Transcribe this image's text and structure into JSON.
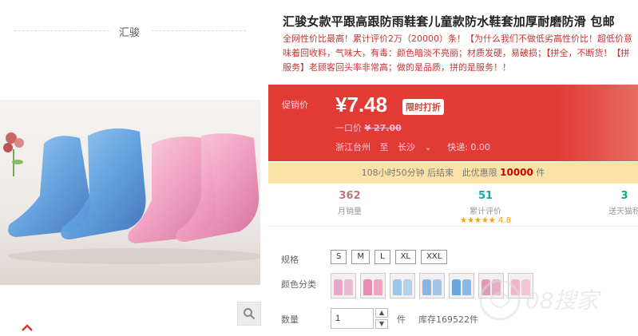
{
  "brand": {
    "name": "汇骏"
  },
  "product": {
    "title": "汇骏女款平跟高跟防雨鞋套儿童款防水鞋套加厚耐磨防滑 包邮",
    "description": "全网性价比最高！累计评价2万（20000）条！【为什么我们不做低劣高性价比！超低价意味着回收料，气味大，有毒：颜色暗淡不亮丽；材质发硬，易破损；【拼全，不断货！【拼服务】老顾客回头率非常高；做的是品质，拼的是服务！！"
  },
  "promo": {
    "label": "促销价",
    "price": "¥7.48",
    "badge": "限时打折",
    "orig_label": "一口价",
    "orig_price": "¥ 27.00",
    "origin": "浙江台州",
    "to": "至",
    "dest": "长沙",
    "shipping": "快递: 0.00"
  },
  "countdown": {
    "time": "108小时50分钟 后结束",
    "limit_label": "此优惠限",
    "limit_num": "10000",
    "unit": "件"
  },
  "stats": [
    {
      "num": "362",
      "label": "月销量"
    },
    {
      "num": "51",
      "label": "累计评价",
      "rating": "4.8"
    },
    {
      "num": "3",
      "label": "送天猫积"
    }
  ],
  "options": {
    "size_label": "规格",
    "sizes": [
      "S",
      "M",
      "L",
      "XL",
      "XXL"
    ],
    "color_label": "颜色分类",
    "color_swatches": [
      "#e6a8c6",
      "#e88bb0",
      "#9fc6e8",
      "#8bb4e0",
      "#6aa6e0",
      "#e09ab8",
      "#f0b6cc"
    ]
  },
  "quantity": {
    "label": "数量",
    "value": "1",
    "unit": "件",
    "stock": "库存169522件"
  },
  "colors": {
    "accent": "#e23b35",
    "band": "#fbe3a8",
    "rating_star": "#f6a100"
  }
}
